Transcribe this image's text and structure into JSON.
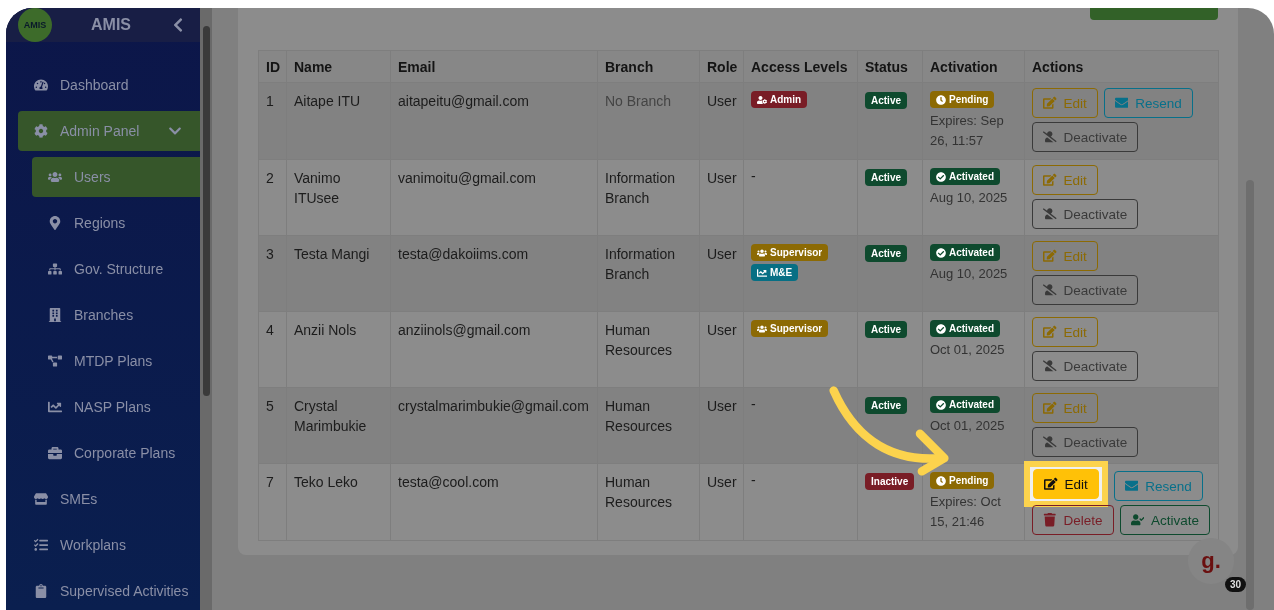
{
  "sidebar": {
    "logo_text": "AMIS",
    "title": "AMIS",
    "items": [
      {
        "label": "Dashboard",
        "selected": false
      },
      {
        "label": "Admin Panel",
        "selected": true,
        "expanded": true,
        "children": [
          {
            "label": "Users",
            "selected": true
          },
          {
            "label": "Regions",
            "selected": false
          },
          {
            "label": "Gov. Structure",
            "selected": false
          },
          {
            "label": "Branches",
            "selected": false
          },
          {
            "label": "MTDP Plans",
            "selected": false
          },
          {
            "label": "NASP Plans",
            "selected": false
          },
          {
            "label": "Corporate Plans",
            "selected": false
          }
        ]
      },
      {
        "label": "SMEs",
        "selected": false
      },
      {
        "label": "Workplans",
        "selected": false
      },
      {
        "label": "Supervised Activities",
        "selected": false
      }
    ]
  },
  "table": {
    "columns": [
      "ID",
      "Name",
      "Email",
      "Branch",
      "Role",
      "Access Levels",
      "Status",
      "Activation",
      "Actions"
    ],
    "rows": [
      {
        "id": "1",
        "name": "Aitape ITU",
        "email": "aitapeitu@gmail.com",
        "branch": "No Branch",
        "branch_assigned": false,
        "role": "User",
        "access": [
          {
            "label": "Admin",
            "kind": "admin",
            "color": "#791d26"
          }
        ],
        "status": {
          "label": "Active",
          "kind": "active"
        },
        "activation": {
          "label": "Pending",
          "kind": "pending",
          "detail": "Expires: Sep 26, 11:57"
        },
        "actions": [
          {
            "label": "Edit",
            "kind": "edit",
            "highlighted": false
          },
          {
            "label": "Resend",
            "kind": "resend",
            "highlighted": false
          },
          {
            "label": "Deactivate",
            "kind": "deactivate",
            "highlighted": false
          }
        ]
      },
      {
        "id": "2",
        "name": "Vanimo ITUsee",
        "email": "vanimoitu@gmail.com",
        "branch": "Information Branch",
        "branch_assigned": true,
        "role": "User",
        "access_empty": "-",
        "status": {
          "label": "Active",
          "kind": "active"
        },
        "activation": {
          "label": "Activated",
          "kind": "activated",
          "detail": "Aug 10, 2025"
        },
        "actions": [
          {
            "label": "Edit",
            "kind": "edit",
            "highlighted": false
          },
          {
            "label": "Deactivate",
            "kind": "deactivate",
            "highlighted": false
          }
        ]
      },
      {
        "id": "3",
        "name": "Testa Mangi",
        "email": "testa@dakoiims.com",
        "branch": "Information Branch",
        "branch_assigned": true,
        "role": "User",
        "access": [
          {
            "label": "Supervisor",
            "kind": "supervisor",
            "color": "#8c6a04"
          },
          {
            "label": "M&E",
            "kind": "me",
            "color": "#076f84"
          }
        ],
        "status": {
          "label": "Active",
          "kind": "active"
        },
        "activation": {
          "label": "Activated",
          "kind": "activated",
          "detail": "Aug 10, 2025"
        },
        "actions": [
          {
            "label": "Edit",
            "kind": "edit",
            "highlighted": false
          },
          {
            "label": "Deactivate",
            "kind": "deactivate",
            "highlighted": false
          }
        ]
      },
      {
        "id": "4",
        "name": "Anzii Nols",
        "email": "anziinols@gmail.com",
        "branch": "Human Resources",
        "branch_assigned": true,
        "role": "User",
        "access": [
          {
            "label": "Supervisor",
            "kind": "supervisor",
            "color": "#8c6a04"
          }
        ],
        "status": {
          "label": "Active",
          "kind": "active"
        },
        "activation": {
          "label": "Activated",
          "kind": "activated",
          "detail": "Oct 01, 2025"
        },
        "actions": [
          {
            "label": "Edit",
            "kind": "edit",
            "highlighted": false
          },
          {
            "label": "Deactivate",
            "kind": "deactivate",
            "highlighted": false
          }
        ]
      },
      {
        "id": "5",
        "name": "Crystal Marimbukie",
        "email": "crystalmarimbukie@gmail.com",
        "branch": "Human Resources",
        "branch_assigned": true,
        "role": "User",
        "access_empty": "-",
        "status": {
          "label": "Active",
          "kind": "active"
        },
        "activation": {
          "label": "Activated",
          "kind": "activated",
          "detail": "Oct 01, 2025"
        },
        "actions": [
          {
            "label": "Edit",
            "kind": "edit",
            "highlighted": false
          },
          {
            "label": "Deactivate",
            "kind": "deactivate",
            "highlighted": false
          }
        ]
      },
      {
        "id": "7",
        "name": "Teko Leko",
        "email": "testa@cool.com",
        "branch": "Human Resources",
        "branch_assigned": true,
        "role": "User",
        "access_empty": "-",
        "status": {
          "label": "Inactive",
          "kind": "inactive"
        },
        "activation": {
          "label": "Pending",
          "kind": "pending",
          "detail": "Expires: Oct 15, 21:46"
        },
        "actions": [
          {
            "label": "Edit",
            "kind": "edit",
            "highlighted": true
          },
          {
            "label": "Resend",
            "kind": "resend",
            "highlighted": false
          },
          {
            "label": "Delete",
            "kind": "delete",
            "highlighted": false
          },
          {
            "label": "Activate",
            "kind": "activate",
            "highlighted": false
          }
        ]
      }
    ]
  },
  "chat_widget": {
    "logo": "g.",
    "count": "30"
  }
}
